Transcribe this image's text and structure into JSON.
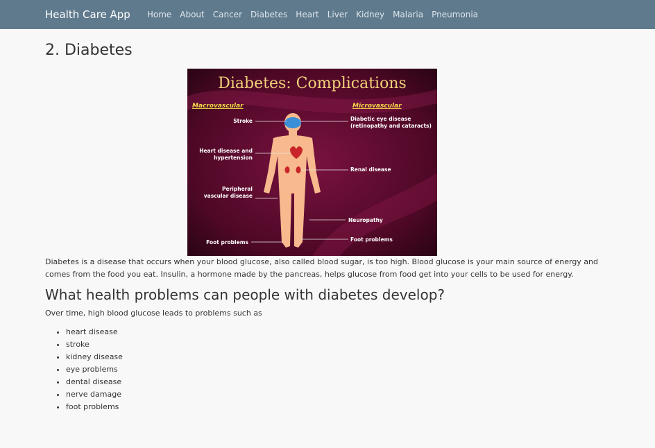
{
  "navbar": {
    "brand": "Health Care App",
    "links": [
      "Home",
      "About",
      "Cancer",
      "Diabetes",
      "Heart",
      "Liver",
      "Kidney",
      "Malaria",
      "Pneumonia"
    ]
  },
  "page": {
    "title": "2. Diabetes",
    "intro": "Diabetes is a disease that occurs when your blood glucose, also called blood sugar, is too high. Blood glucose is your main source of energy and comes from the food you eat. Insulin, a hormone made by the pancreas, helps glucose from food get into your cells to be used for energy.",
    "subheading": "What health problems can people with diabetes develop?",
    "lead": "Over time, high blood glucose leads to problems such as",
    "problems": [
      "heart disease",
      "stroke",
      "kidney disease",
      "eye problems",
      "dental disease",
      "nerve damage",
      "foot problems"
    ]
  },
  "figure": {
    "title": "Diabetes: Complications",
    "left_header": "Macrovascular",
    "right_header": "Microvascular",
    "left_labels": [
      "Stroke",
      "Heart disease and",
      "hypertension",
      "Peripheral",
      "vascular disease",
      "Foot problems"
    ],
    "right_labels": [
      "Diabetic eye disease",
      "(retinopathy and cataracts)",
      "Renal disease",
      "Neuropathy",
      "Foot problems"
    ],
    "colors": {
      "background": "#5a0a2c",
      "title": "#f2d27a",
      "header": "#f5d84a",
      "skin": "#f7b98d",
      "brain": "#3a8fd6",
      "organ": "#c8242a"
    }
  }
}
